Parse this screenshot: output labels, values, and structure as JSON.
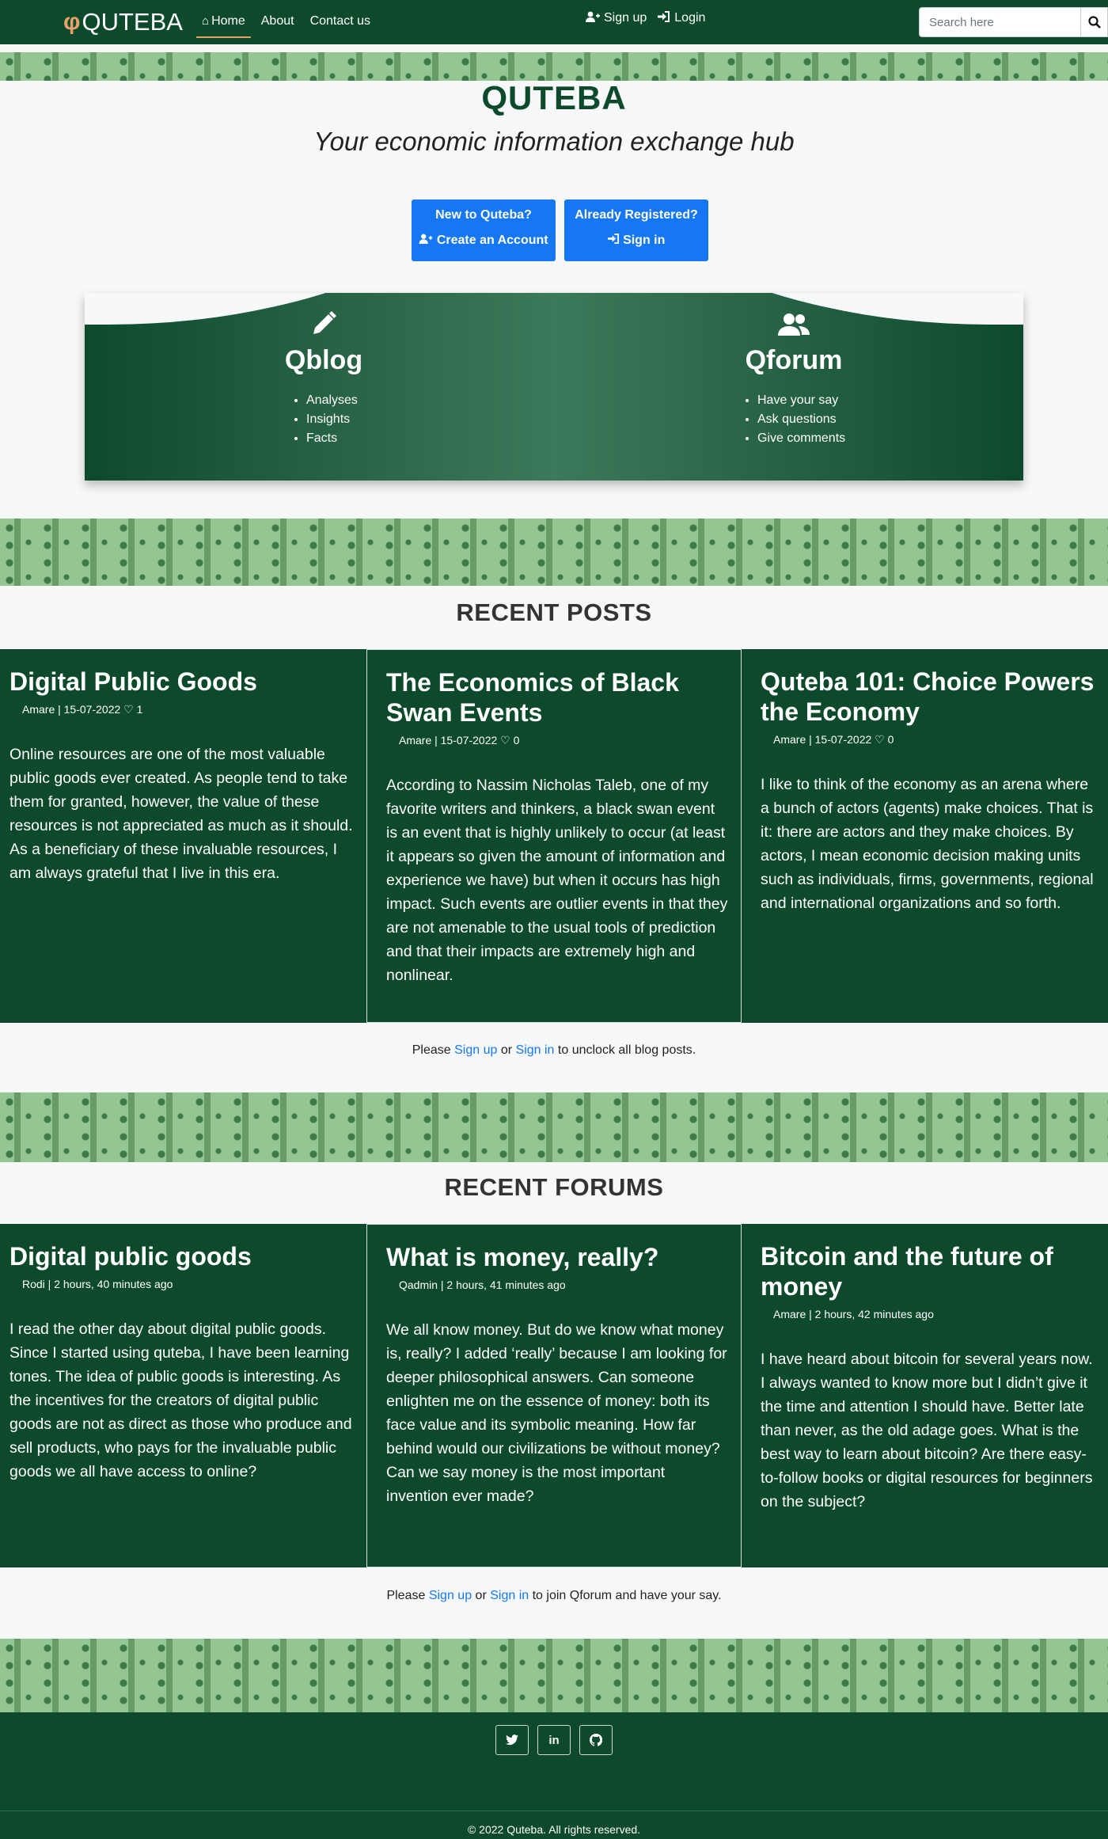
{
  "nav": {
    "brand": "QUTEBA",
    "links": [
      "Home",
      "About",
      "Contact us"
    ],
    "signup": "Sign up",
    "login": "Login",
    "search_placeholder": "Search here"
  },
  "hero": {
    "title": "QUTEBA",
    "subtitle": "Your economic information exchange hub",
    "cta_new_line1": "New to Quteba?",
    "cta_new_line2": "Create an Account",
    "cta_reg_line1": "Already Registered?",
    "cta_reg_line2": "Sign in"
  },
  "book": {
    "left": {
      "title": "Qblog",
      "items": [
        "Analyses",
        "Insights",
        "Facts"
      ]
    },
    "right": {
      "title": "Qforum",
      "items": [
        "Have your say",
        "Ask questions",
        "Give comments"
      ]
    }
  },
  "posts": {
    "heading": "RECENT POSTS",
    "items": [
      {
        "title": "Digital Public Goods",
        "meta": "Amare | 15-07-2022",
        "likes": "1",
        "body": "Online resources are one of the most valuable public goods ever created. As people tend to take them for granted, however, the value of these resources is not appreciated as much as it should. As a beneficiary of these invaluable resources, I am always grateful that I live in this era."
      },
      {
        "title": "The Economics of Black Swan Events",
        "meta": "Amare | 15-07-2022",
        "likes": "0",
        "body": "According to Nassim Nicholas Taleb, one of my favorite writers and thinkers, a black swan event is an event that is highly unlikely to occur (at least it appears so given the amount of information and experience we have) but when it occurs has high impact. Such events are outlier events in that they are not amenable to the usual tools of prediction and that their impacts are extremely high and nonlinear."
      },
      {
        "title": "Quteba 101: Choice Powers the Economy",
        "meta": "Amare | 15-07-2022",
        "likes": "0",
        "body": "I like to think of the economy as an arena where a bunch of actors (agents) make choices. That is it: there are actors and they make choices. By actors, I mean economic decision making units such as individuals, firms, governments, regional and international organizations and so forth."
      }
    ],
    "notice_pre": "Please",
    "notice_signup": "Sign up",
    "notice_or": "or",
    "notice_signin": "Sign in",
    "notice_post": "to unclock all blog posts."
  },
  "forums": {
    "heading": "RECENT FORUMS",
    "items": [
      {
        "title": "Digital public goods",
        "meta": "Rodi | 2 hours, 40 minutes ago",
        "body": "I read the other day about digital public goods. Since I started using quteba, I have been learning tones. The idea of public goods is interesting. As the incentives for the creators of digital public goods are not as direct as those who produce and sell products, who pays for the invaluable public goods we all have access to online?"
      },
      {
        "title": "What is money, really?",
        "meta": "Qadmin | 2 hours, 41 minutes ago",
        "body": "We all know money. But do we know what money is, really? I added ‘really’ because I am looking for deeper philosophical answers. Can someone enlighten me on the essence of money: both its face value and its symbolic meaning. How far behind would our civilizations be without money? Can we say money is the most important invention ever made?"
      },
      {
        "title": "Bitcoin and the future of money",
        "meta": "Amare | 2 hours, 42 minutes ago",
        "body": "I have heard about bitcoin for several years now. I always wanted to know more but I didn’t give it the time and attention I should have. Better late than never, as the old adage goes. What is the best way to learn about bitcoin? Are there easy-to-follow books or digital resources for beginners on the subject?"
      }
    ],
    "notice_pre": "Please",
    "notice_signup": "Sign up",
    "notice_or": "or",
    "notice_signin": "Sign in",
    "notice_post": "to join Qforum and have your say."
  },
  "footer": {
    "copyright": "2022 Quteba. All rights reserved."
  },
  "colors": {
    "brand_green": "#0d4a2c",
    "accent_orange": "#e8a06b",
    "button_blue": "#1677f5",
    "pattern_green": "#94c593"
  },
  "icons": [
    "logo-icon",
    "home-icon",
    "user-plus-icon",
    "sign-in-icon",
    "search-icon",
    "pencil-icon",
    "users-icon",
    "heart-icon",
    "twitter-icon",
    "linkedin-icon",
    "github-icon",
    "copyright-icon"
  ]
}
